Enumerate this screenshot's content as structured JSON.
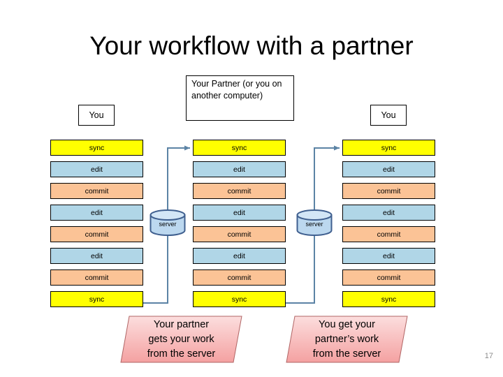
{
  "slide": {
    "title": "Your workflow with a partner",
    "page_number": "17",
    "background_color": "#ffffff"
  },
  "headers": [
    {
      "id": "you-left",
      "label": "You"
    },
    {
      "id": "partner",
      "label": "Your Partner (or you on another computer)"
    },
    {
      "id": "you-right",
      "label": "You"
    }
  ],
  "colors": {
    "sync": "#ffff00",
    "edit": "#b0d6e7",
    "commit": "#fbc396",
    "connector": "#5b83a5",
    "server_fill": "#bcd8ef",
    "server_stroke": "#3f5f8f",
    "banner_fill_top": "#fbdcdc",
    "banner_fill_bottom": "#f5a6a6",
    "banner_stroke": "#b06060",
    "box_stroke": "#000000",
    "page_number": "#8c8c8c"
  },
  "columns": [
    {
      "id": "column-1",
      "owner": "You",
      "steps": [
        {
          "label": "sync",
          "kind": "sync"
        },
        {
          "label": "edit",
          "kind": "edit"
        },
        {
          "label": "commit",
          "kind": "commit"
        },
        {
          "label": "edit",
          "kind": "edit"
        },
        {
          "label": "commit",
          "kind": "commit"
        },
        {
          "label": "edit",
          "kind": "edit"
        },
        {
          "label": "commit",
          "kind": "commit"
        },
        {
          "label": "sync",
          "kind": "sync"
        }
      ]
    },
    {
      "id": "column-2",
      "owner": "Your Partner (or you on another computer)",
      "steps": [
        {
          "label": "sync",
          "kind": "sync"
        },
        {
          "label": "edit",
          "kind": "edit"
        },
        {
          "label": "commit",
          "kind": "commit"
        },
        {
          "label": "edit",
          "kind": "edit"
        },
        {
          "label": "commit",
          "kind": "commit"
        },
        {
          "label": "edit",
          "kind": "edit"
        },
        {
          "label": "commit",
          "kind": "commit"
        },
        {
          "label": "sync",
          "kind": "sync"
        }
      ]
    },
    {
      "id": "column-3",
      "owner": "You",
      "steps": [
        {
          "label": "sync",
          "kind": "sync"
        },
        {
          "label": "edit",
          "kind": "edit"
        },
        {
          "label": "commit",
          "kind": "commit"
        },
        {
          "label": "edit",
          "kind": "edit"
        },
        {
          "label": "commit",
          "kind": "commit"
        },
        {
          "label": "edit",
          "kind": "edit"
        },
        {
          "label": "commit",
          "kind": "commit"
        },
        {
          "label": "sync",
          "kind": "sync"
        }
      ]
    }
  ],
  "servers": [
    {
      "id": "server-1",
      "label": "server"
    },
    {
      "id": "server-2",
      "label": "server"
    }
  ],
  "banners": [
    {
      "id": "banner-1",
      "text": "Your partner\ngets your work\nfrom the server"
    },
    {
      "id": "banner-2",
      "text": "You get your\npartner’s work\nfrom the server"
    }
  ]
}
